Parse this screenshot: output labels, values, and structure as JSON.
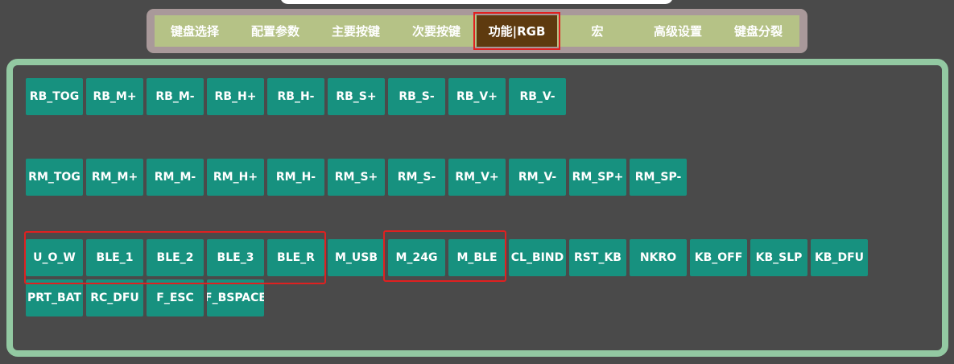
{
  "tabs": [
    {
      "label": "键盘选择"
    },
    {
      "label": "配置参数"
    },
    {
      "label": "主要按键"
    },
    {
      "label": "次要按键"
    },
    {
      "label": "功能|RGB"
    },
    {
      "label": "宏"
    },
    {
      "label": "高级设置"
    },
    {
      "label": "键盘分裂"
    }
  ],
  "active_tab": "功能|RGB",
  "keys": {
    "row1": [
      "RB_TOG",
      "RB_M+",
      "RB_M-",
      "RB_H+",
      "RB_H-",
      "RB_S+",
      "RB_S-",
      "RB_V+",
      "RB_V-"
    ],
    "row2": [
      "RM_TOG",
      "RM_M+",
      "RM_M-",
      "RM_H+",
      "RM_H-",
      "RM_S+",
      "RM_S-",
      "RM_V+",
      "RM_V-",
      "RM_SP+",
      "RM_SP-"
    ],
    "row3": [
      "U_O_W",
      "BLE_1",
      "BLE_2",
      "BLE_3",
      "BLE_R",
      "M_USB",
      "M_24G",
      "M_BLE",
      "CL_BIND",
      "RST_KB",
      "NKRO",
      "KB_OFF",
      "KB_SLP",
      "KB_DFU"
    ],
    "row4": [
      "PRT_BAT",
      "RC_DFU",
      "F_ESC",
      "F_BSPACE"
    ]
  },
  "colors": {
    "background": "#4a4a4a",
    "key": "#17917f",
    "tab_bar": "#b5c286",
    "tab_active": "#5e3a0f",
    "panel_border": "#93c9a2",
    "highlight": "#e02020"
  }
}
